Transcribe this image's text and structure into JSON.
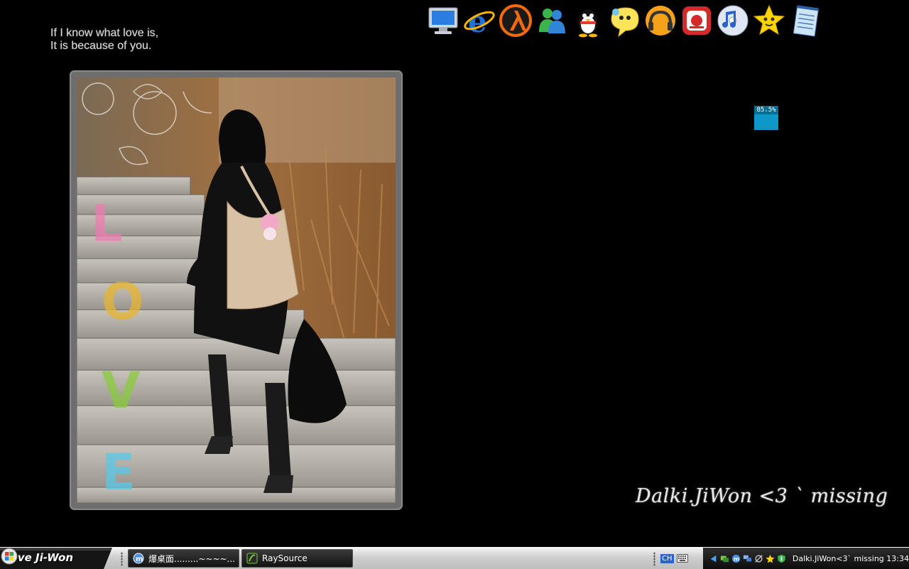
{
  "desktop": {
    "quote": {
      "line1": "If I know what love is,",
      "line2": "It is because of you."
    },
    "signature": "Dalki.JiWon <3 ` missing",
    "meter": {
      "label": "85.5%",
      "value_percent": 85.5
    },
    "photo": {
      "love_letters": [
        "L",
        "O",
        "V",
        "E"
      ]
    },
    "dock_icons": [
      "my-computer-icon",
      "internet-explorer-icon",
      "half-life-icon",
      "msn-messenger-icon",
      "qq-penguin-icon",
      "chat-bubble-icon",
      "music-headphones-icon",
      "media-player-icon",
      "itunes-icon",
      "star-face-icon",
      "notepad-icon"
    ]
  },
  "taskbar": {
    "start_label": "Love Ji-Won",
    "tasks": [
      {
        "label": "爆桌面.........~~~~...",
        "icon": "maxthon-icon"
      },
      {
        "label": "RaySource",
        "icon": "raysource-icon"
      }
    ],
    "language": "CH",
    "tray_icons": [
      "arrow-icon",
      "network-icon",
      "maxthon-tray-icon",
      "monitor-icon",
      "satellite-icon",
      "star-tray-icon",
      "shield-icon"
    ],
    "clock_text": "Dalki.JiWon<3` missing 13:34"
  },
  "colors": {
    "meter": "#0e97c9",
    "start_button": "#151515",
    "taskbar": "#cfcfcf"
  }
}
